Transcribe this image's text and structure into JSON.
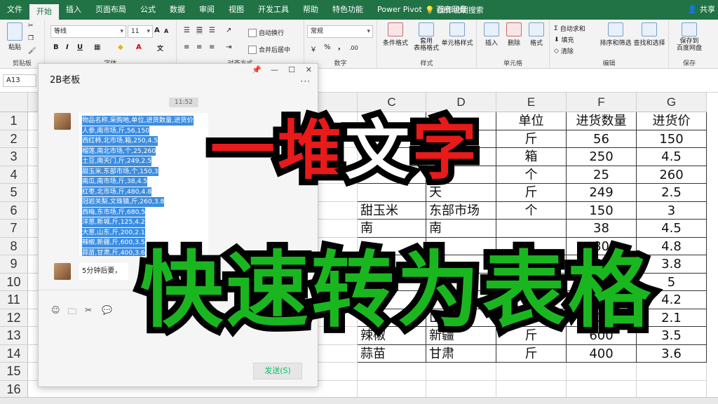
{
  "ribbon_tabs": [
    "文件",
    "开始",
    "插入",
    "页面布局",
    "公式",
    "数据",
    "审阅",
    "视图",
    "开发工具",
    "帮助",
    "特色功能",
    "Power Pivot",
    "百度网盘"
  ],
  "active_tab": "开始",
  "tell_me": "操作说明搜索",
  "share": "共享",
  "clipboard": {
    "paste": "粘贴",
    "label": "剪贴板"
  },
  "font": {
    "name": "等线",
    "size": "11",
    "label": "字体"
  },
  "alignment": {
    "wrap": "自动换行",
    "merge": "合并后居中",
    "label": "对齐方式"
  },
  "number": {
    "format": "常规",
    "label": "数字"
  },
  "styles": {
    "conditional": "条件格式",
    "table": "套用\n表格格式",
    "cell_style": "单元格样式",
    "label": "样式"
  },
  "cells": {
    "insert": "插入",
    "delete": "删除",
    "format": "格式",
    "label": "单元格"
  },
  "editing": {
    "autosum": "自动求和",
    "fill": "填充",
    "clear": "清除",
    "sort": "排序和筛选",
    "find": "查找和选择",
    "label": "编辑"
  },
  "save": {
    "button": "保存到\n百度网盘",
    "label": "保存"
  },
  "name_box": "A13",
  "columns": [
    "C",
    "D",
    "E",
    "F",
    "G"
  ],
  "rows": [
    "1",
    "2",
    "3",
    "4",
    "5",
    "6",
    "7",
    "8",
    "9",
    "10",
    "11",
    "12",
    "13",
    "14",
    "15",
    "16"
  ],
  "table": {
    "headers": [
      "单位",
      "进货数量",
      "进货价"
    ],
    "rows": [
      {
        "c": "",
        "d": "",
        "e": "斤",
        "f": "56",
        "g": "150"
      },
      {
        "c": "西红",
        "d": "北",
        "e": "箱",
        "f": "250",
        "g": "4.5"
      },
      {
        "c": "",
        "d": "",
        "e": "个",
        "f": "25",
        "g": "260"
      },
      {
        "c": "",
        "d": "天",
        "e": "斤",
        "f": "249",
        "g": "2.5"
      },
      {
        "c": "甜玉米",
        "d": "东部市场",
        "e": "个",
        "f": "150",
        "g": "3"
      },
      {
        "c": "南",
        "d": "南",
        "e": "",
        "f": "38",
        "g": "4.5"
      },
      {
        "c": "",
        "d": "",
        "e": "",
        "f": "80",
        "g": "4.8"
      },
      {
        "c": "",
        "d": "",
        "e": "",
        "f": "60",
        "g": "3.8"
      },
      {
        "c": "西",
        "d": "",
        "e": "",
        "f": "30",
        "g": "5"
      },
      {
        "c": "",
        "d": "",
        "e": "",
        "f": "25",
        "g": "4.2"
      },
      {
        "c": "",
        "d": "山东",
        "e": "",
        "f": "00",
        "g": "2.1"
      },
      {
        "c": "辣椒",
        "d": "新疆",
        "e": "斤",
        "f": "600",
        "g": "3.5"
      },
      {
        "c": "蒜苗",
        "d": "甘肃",
        "e": "斤",
        "f": "400",
        "g": "3.6"
      }
    ]
  },
  "chat": {
    "title": "2B老板",
    "time": "11:52",
    "lines": [
      "物品名称,采购地,单位,进货数量,进货价",
      "人参,南市场,斤,56,150",
      "西红柿,北市场,箱,250,4.5",
      "榴莲,南北市场,个,25,260",
      "土豆,南天门,斤,249,2.5",
      "甜玉米,东部市场,个,150,3",
      "南瓜,南市场,斤,38,4.5",
      "红枣,北市场,斤,480,4.8",
      "冠岩关梨,文珠镇,斤,260,3.8",
      "西梅,东市场,斤,680,5",
      "洋葱,新城,斤,125,4.2",
      "大葱,山东,斤,200,2.1",
      "辣椒,新疆,斤,600,3.5",
      "蒜苗,甘肃,斤,400,3.6"
    ],
    "reply": "5分钟后要，",
    "send": "发送(S)"
  },
  "overlay": {
    "title1": "一堆文字",
    "title2": "快速转为表格"
  },
  "colors": {
    "excel_green": "#217346",
    "title_red": "#e81a1a",
    "title_green": "#1ab620",
    "selection_blue": "#3c8de0"
  }
}
